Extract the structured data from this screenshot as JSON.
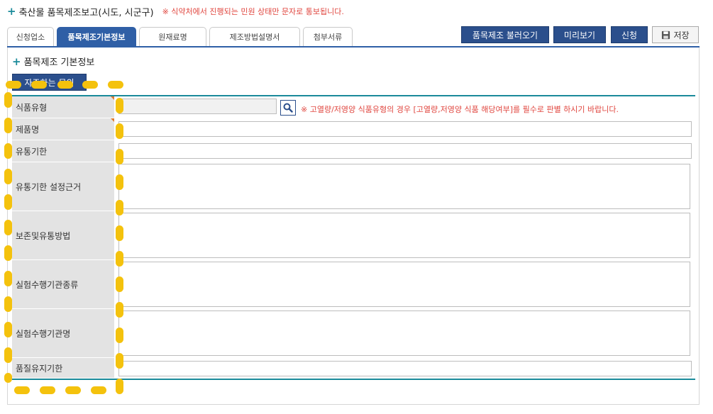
{
  "header": {
    "title": "축산물 품목제조보고(시도, 시군구)",
    "notice": "※ 식약처에서 진행되는 민원 상태만 문자로 통보됩니다."
  },
  "tabs": [
    {
      "label": "신청업소",
      "active": false
    },
    {
      "label": "품목제조기본정보",
      "active": true
    },
    {
      "label": "원재료명",
      "active": false
    },
    {
      "label": "제조방법설명서",
      "active": false
    },
    {
      "label": "첨부서류",
      "active": false
    }
  ],
  "actions": {
    "load": "품목제조 불러오기",
    "preview": "미리보기",
    "submit": "신청",
    "save": "저장"
  },
  "section": {
    "title": "품목제조 기본정보",
    "faq_button": "자주하는 문의"
  },
  "form": {
    "rows": [
      {
        "label": "식품유형",
        "value": "",
        "note": "※ 고열량/저영양 식품유형의 경우 [고열량,저영양 식품 해당여부]를 필수로 판별 하시기 바랍니다."
      },
      {
        "label": "제품명",
        "value": ""
      },
      {
        "label": "유통기한",
        "value": ""
      },
      {
        "label": "유통기한 설정근거",
        "value": ""
      },
      {
        "label": "보존및유통방법",
        "value": ""
      },
      {
        "label": "실험수행기관종류",
        "value": ""
      },
      {
        "label": "실험수행기관명",
        "value": ""
      },
      {
        "label": "품질유지기한",
        "value": ""
      }
    ]
  },
  "colors": {
    "brand_blue": "#2b4f8c",
    "tab_active": "#2f5fa6",
    "accent_teal": "#1a8a9a",
    "notice_red": "#e0463f",
    "overlay_yellow": "#f4c20d"
  },
  "icons": {
    "section_plus": "plus-icon",
    "search": "search-icon",
    "save": "floppy-disk-icon"
  }
}
